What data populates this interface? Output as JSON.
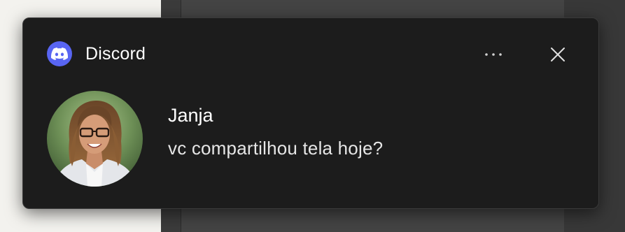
{
  "notification": {
    "app_name": "Discord",
    "app_icon": "discord-logo-icon",
    "sender": "Janja",
    "message": "vc compartilhou tela hoje?",
    "more_icon": "more-options-icon",
    "close_icon": "close-icon",
    "avatar": "sender-avatar-photo"
  },
  "colors": {
    "toast_background": "#1c1c1c",
    "brand": "#5865f2",
    "text_primary": "#ffffff",
    "text_secondary": "#e6e6e6"
  }
}
